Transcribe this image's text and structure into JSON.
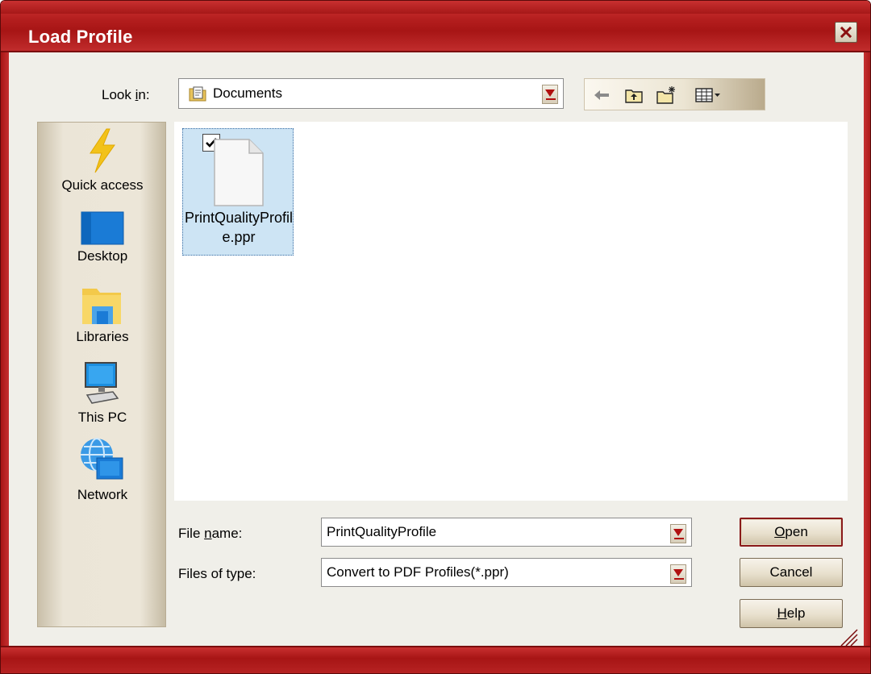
{
  "window": {
    "title": "Load Profile",
    "accent_color": "#b51f1f",
    "close_icon": "close-icon"
  },
  "lookin": {
    "label": "Look in:",
    "label_hotkey": "i",
    "value": "Documents"
  },
  "toolbar": {
    "buttons": [
      "back-arrow-icon",
      "up-folder-icon",
      "new-folder-icon",
      "view-menu-icon"
    ]
  },
  "places": [
    {
      "label": "Quick access",
      "icon": "quick-access-icon"
    },
    {
      "label": "Desktop",
      "icon": "desktop-icon"
    },
    {
      "label": "Libraries",
      "icon": "libraries-icon"
    },
    {
      "label": "This PC",
      "icon": "this-pc-icon"
    },
    {
      "label": "Network",
      "icon": "network-icon"
    }
  ],
  "files": [
    {
      "name": "PrintQualityProfile.ppr",
      "selected": true,
      "checked": true,
      "icon": "document-icon"
    }
  ],
  "filename": {
    "label": "File name:",
    "value": "PrintQualityProfile"
  },
  "filetype": {
    "label": "Files of type:",
    "value": "Convert to PDF Profiles(*.ppr)"
  },
  "buttons": {
    "open": "Open",
    "cancel": "Cancel",
    "help": "Help"
  }
}
